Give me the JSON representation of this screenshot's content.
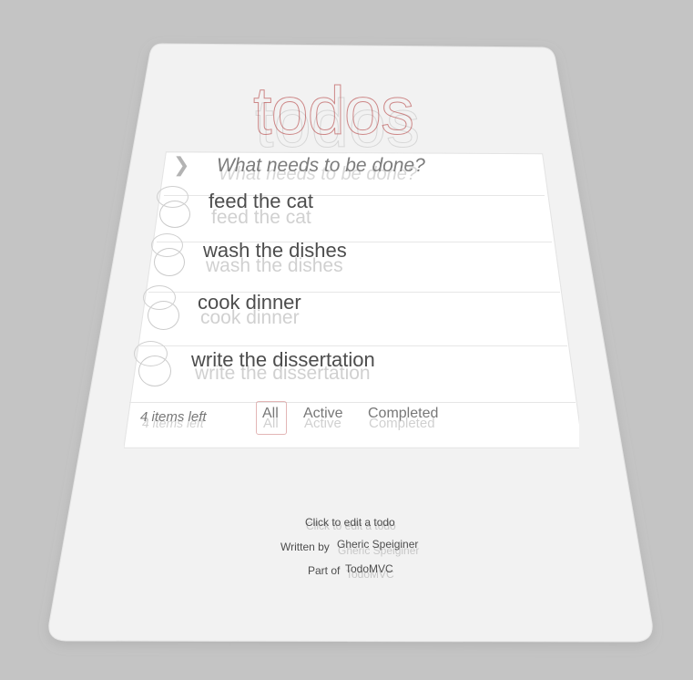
{
  "app": {
    "title": "todos"
  },
  "input": {
    "placeholder": "What needs to be done?"
  },
  "todos": [
    {
      "label": "feed the cat"
    },
    {
      "label": "wash the dishes"
    },
    {
      "label": "cook dinner"
    },
    {
      "label": "write the dissertation"
    }
  ],
  "footer": {
    "count": "4 items left",
    "filters": [
      "All",
      "Active",
      "Completed"
    ],
    "selected_filter": "All"
  },
  "info": {
    "edit_hint": "Click to edit a todo",
    "written_by_label": "Written by",
    "author": "Gheric Speiginer",
    "part_of_label": "Part of",
    "project": "TodoMVC"
  },
  "colors": {
    "background": "#c4c4c4",
    "sheet": "#f2f2f2",
    "card": "#ffffff",
    "title": "#af2f2f",
    "text": "#4d4d4d",
    "muted": "#777777"
  }
}
